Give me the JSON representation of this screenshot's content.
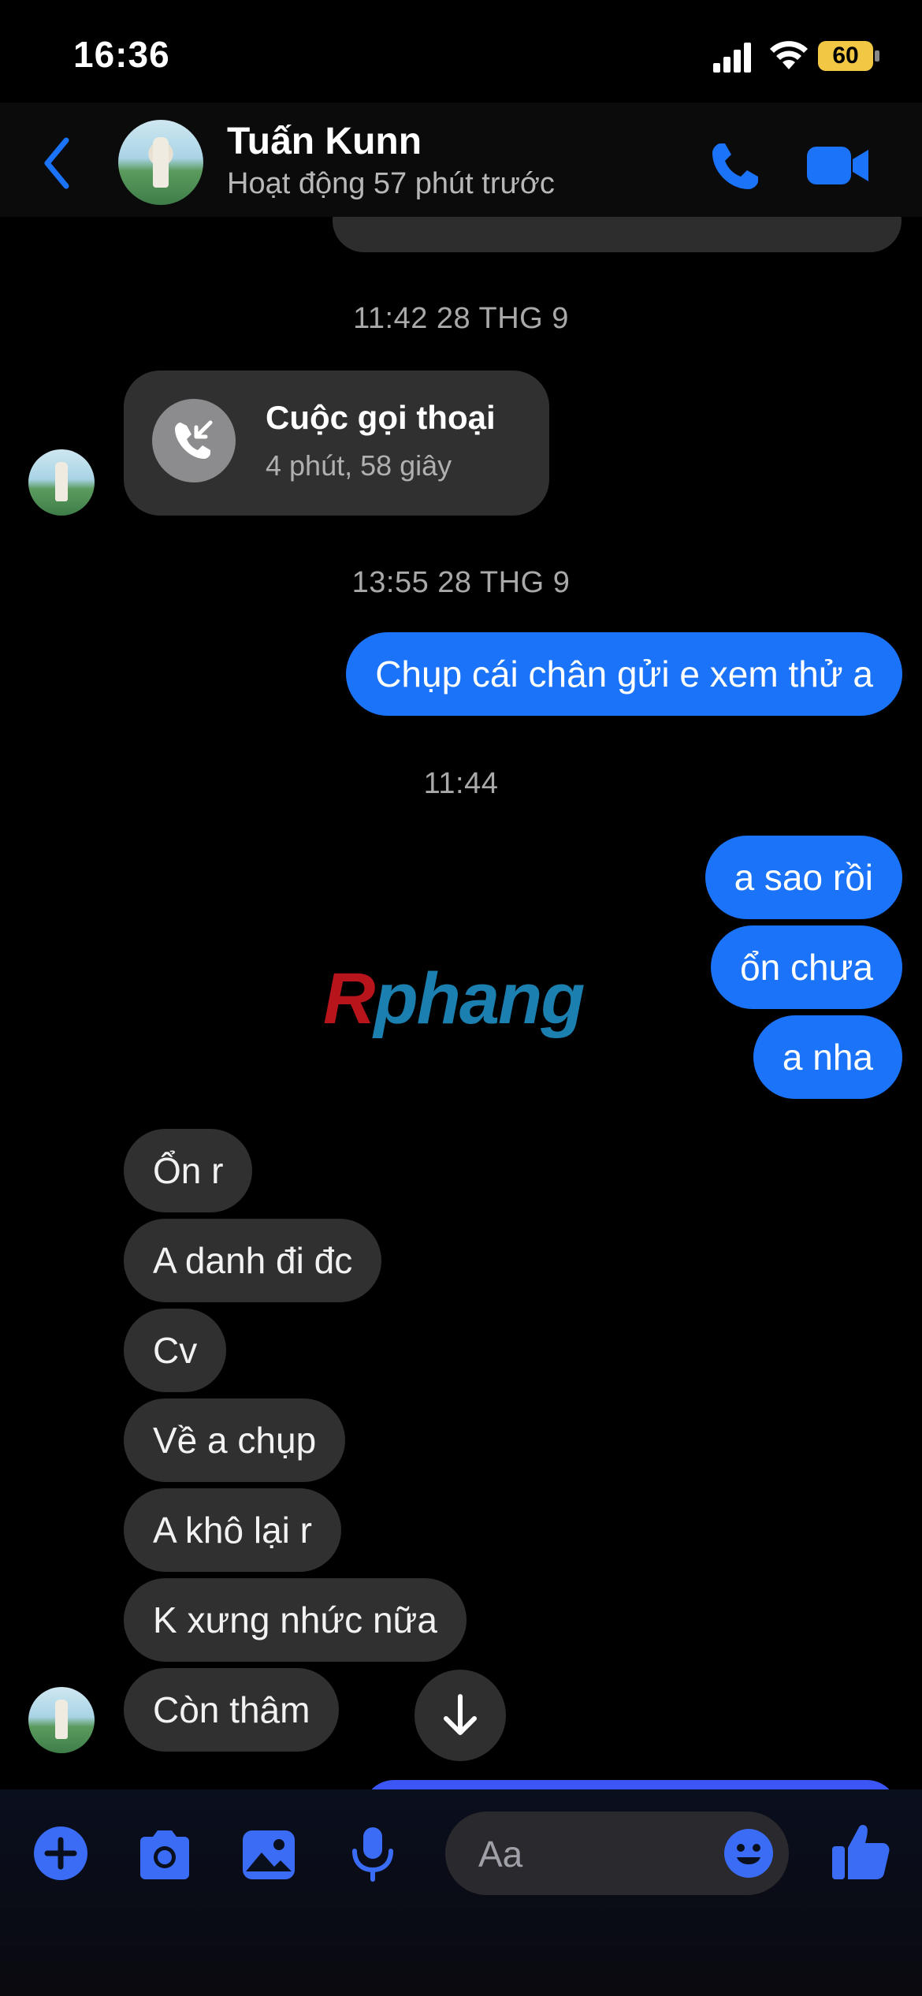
{
  "status_bar": {
    "time": "16:36",
    "battery": "60"
  },
  "header": {
    "contact_name": "Tuấn Kunn",
    "contact_status": "Hoạt động 57 phút trước"
  },
  "messages": {
    "timestamp_1": "11:42 28 THG 9",
    "call": {
      "title": "Cuộc gọi thoại",
      "duration": "4 phút, 58 giây"
    },
    "timestamp_2": "13:55 28 THG 9",
    "outgoing_1": "Chụp cái chân gửi e xem thử a",
    "timestamp_3": "11:44",
    "outgoing_2": [
      "a sao rồi",
      "ổn chưa",
      "a nha"
    ],
    "incoming": [
      "Ổn r",
      "A danh đi đc",
      "Cv",
      "Về a chụp",
      "A khô lại r",
      "K xưng nhức nữa",
      "Còn thâm"
    ]
  },
  "watermark": {
    "first": "R",
    "rest": "phang"
  },
  "composer": {
    "placeholder": "Aa"
  },
  "colors": {
    "accent": "#1a73f8",
    "icon_blue": "#3b6cf6",
    "bubble_in": "#303030"
  }
}
